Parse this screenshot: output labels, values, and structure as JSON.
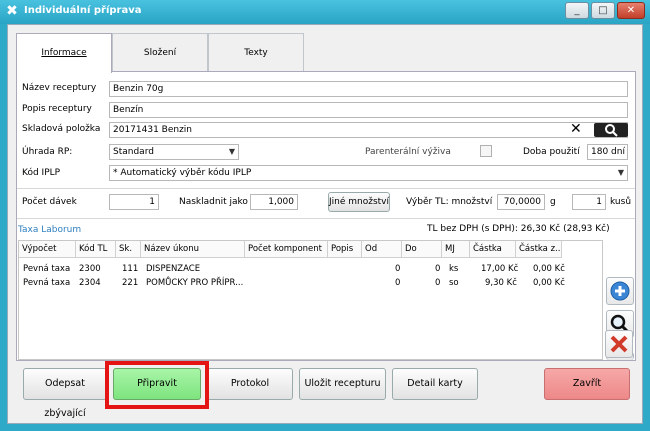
{
  "window": {
    "title": "Individuální příprava",
    "minimize": "_",
    "maximize": "□",
    "close": "✕"
  },
  "tabs": [
    {
      "label": "Informace",
      "active": true
    },
    {
      "label": "Složení",
      "active": false
    },
    {
      "label": "Texty",
      "active": false
    }
  ],
  "form": {
    "nazev_receptury_label": "Název receptury",
    "nazev_receptury_value": "Benzin 70g",
    "popis_receptury_label": "Popis receptury",
    "popis_receptury_value": "Benzín",
    "skladova_polozka_label": "Skladová položka",
    "skladova_polozka_value": "20171431   Benzin",
    "uhrada_label": "Úhrada RP:",
    "uhrada_value": "Standard",
    "parenteralni_label": "Parenterální výživa",
    "doba_pouziti_label": "Doba použití",
    "doba_pouziti_value": "180 dní",
    "kod_iplp_label": "Kód IPLP",
    "kod_iplp_value": "* Automatický výběr kódu IPLP"
  },
  "quantity": {
    "pocet_davek_label": "Počet dávek",
    "pocet_davek_value": "1",
    "naskladnit_label": "Naskladnit jako",
    "naskladnit_value": "1,000",
    "jine_mnozstvi_button": "Jiné množství",
    "vyber_tl_label": "Výběr TL: množství",
    "vyber_tl_value": "70,0000",
    "unit_g": "g",
    "kusu_value": "1",
    "kusu_label": "kusů"
  },
  "taxa": {
    "section_title": "Taxa Laborum",
    "tl_summary": "TL bez DPH (s DPH):   26,30 Kč (28,93 Kč)",
    "columns": [
      "Výpočet",
      "Kód TL",
      "Sk.",
      "Název úkonu",
      "Počet komponent",
      "Popis",
      "Od",
      "Do",
      "MJ",
      "Částka",
      "Částka z..."
    ],
    "rows": [
      {
        "vypocet": "Pevná taxa",
        "kod": "2300",
        "sk": "111",
        "nazev": "DISPENZACE",
        "od": "0",
        "do": "0",
        "mj": "ks",
        "castka": "17,00 Kč",
        "castka_z": "0,00 Kč"
      },
      {
        "vypocet": "Pevná taxa",
        "kod": "2304",
        "sk": "221",
        "nazev": "POMŮCKY PRO PŘÍPR...",
        "od": "0",
        "do": "0",
        "mj": "so",
        "castka": "9,30 Kč",
        "castka_z": "0,00 Kč"
      }
    ]
  },
  "buttons": {
    "odepsat": "Odepsat zbývající",
    "pripravit": "Připravit",
    "protokol": "Protokol",
    "ulozit": "Uložit recepturu",
    "detail": "Detail karty",
    "zavrit": "Zavřít"
  },
  "colors": {
    "titlebar": "#2aa4c4",
    "pripravit_bg": "#8ef08e",
    "zavrit_bg": "#f09090",
    "highlight": "#e41414"
  }
}
